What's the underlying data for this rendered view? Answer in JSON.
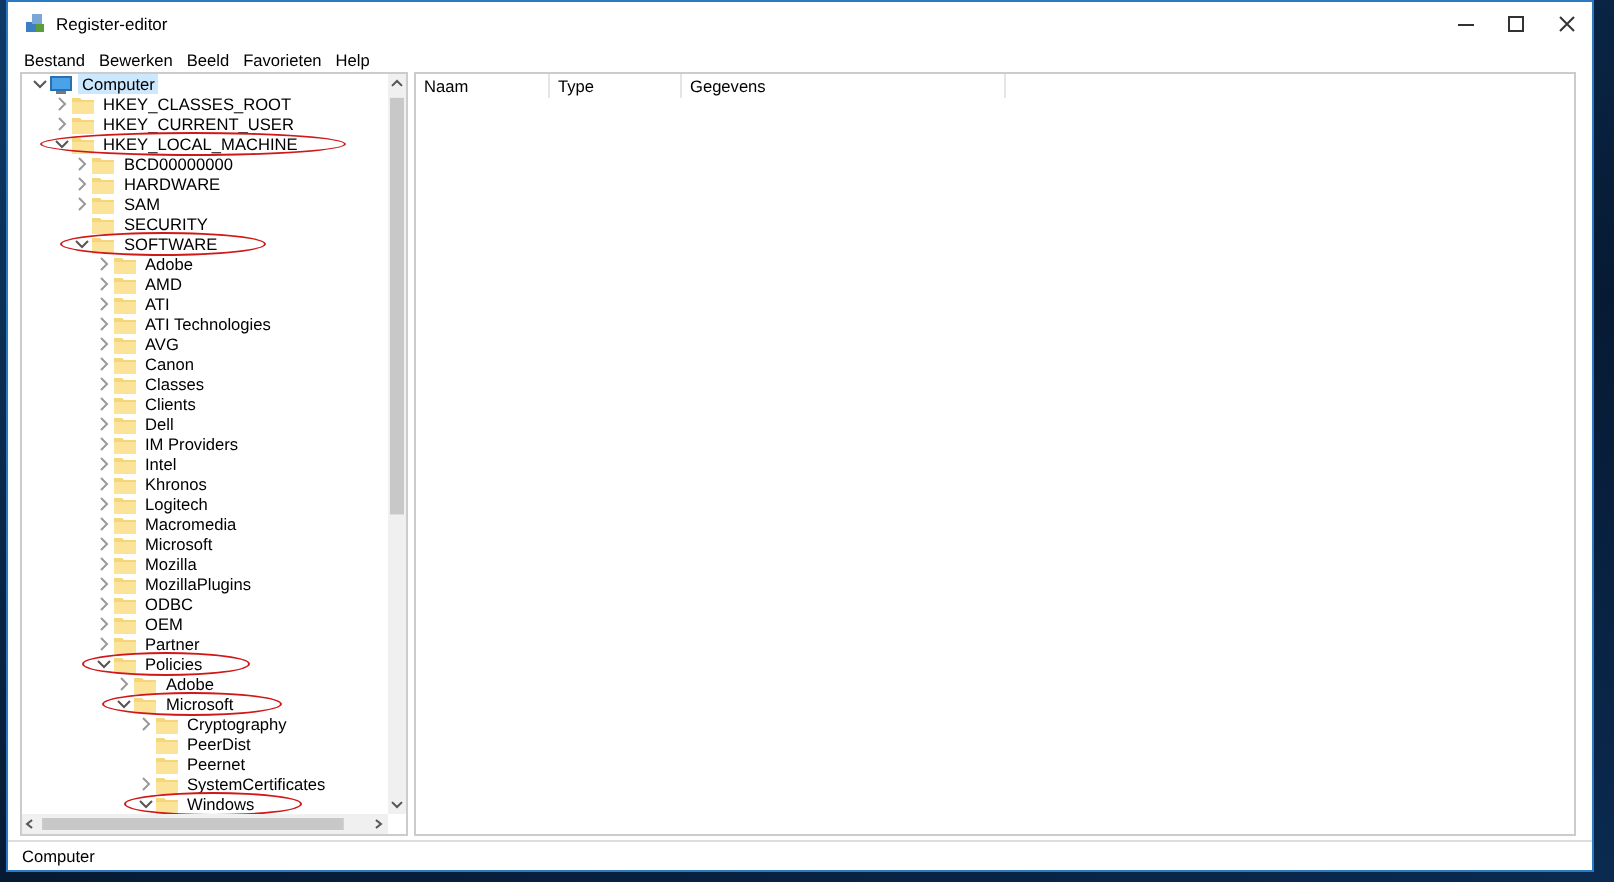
{
  "window": {
    "title": "Register-editor"
  },
  "menu": [
    "Bestand",
    "Bewerken",
    "Beeld",
    "Favorieten",
    "Help"
  ],
  "tree": [
    {
      "label": "Computer",
      "expanded": true,
      "selected": true,
      "circled": false,
      "children": [
        {
          "label": "HKEY_CLASSES_ROOT",
          "expanded": false,
          "selected": false,
          "circled": false
        },
        {
          "label": "HKEY_CURRENT_USER",
          "expanded": false,
          "selected": false,
          "circled": false
        },
        {
          "label": "HKEY_LOCAL_MACHINE",
          "expanded": true,
          "selected": false,
          "circled": true,
          "children": [
            {
              "label": "BCD00000000",
              "expanded": false,
              "selected": false,
              "circled": false
            },
            {
              "label": "HARDWARE",
              "expanded": false,
              "selected": false,
              "circled": false
            },
            {
              "label": "SAM",
              "expanded": false,
              "selected": false,
              "circled": false
            },
            {
              "label": "SECURITY",
              "kind": "leaf",
              "selected": false,
              "circled": false
            },
            {
              "label": "SOFTWARE",
              "expanded": true,
              "selected": false,
              "circled": true,
              "children": [
                {
                  "label": "Adobe",
                  "expanded": false,
                  "selected": false,
                  "circled": false
                },
                {
                  "label": "AMD",
                  "expanded": false,
                  "selected": false,
                  "circled": false
                },
                {
                  "label": "ATI",
                  "expanded": false,
                  "selected": false,
                  "circled": false
                },
                {
                  "label": "ATI Technologies",
                  "expanded": false,
                  "selected": false,
                  "circled": false
                },
                {
                  "label": "AVG",
                  "expanded": false,
                  "selected": false,
                  "circled": false
                },
                {
                  "label": "Canon",
                  "expanded": false,
                  "selected": false,
                  "circled": false
                },
                {
                  "label": "Classes",
                  "expanded": false,
                  "selected": false,
                  "circled": false
                },
                {
                  "label": "Clients",
                  "expanded": false,
                  "selected": false,
                  "circled": false
                },
                {
                  "label": "Dell",
                  "expanded": false,
                  "selected": false,
                  "circled": false
                },
                {
                  "label": "IM Providers",
                  "expanded": false,
                  "selected": false,
                  "circled": false
                },
                {
                  "label": "Intel",
                  "expanded": false,
                  "selected": false,
                  "circled": false
                },
                {
                  "label": "Khronos",
                  "expanded": false,
                  "selected": false,
                  "circled": false
                },
                {
                  "label": "Logitech",
                  "expanded": false,
                  "selected": false,
                  "circled": false
                },
                {
                  "label": "Macromedia",
                  "expanded": false,
                  "selected": false,
                  "circled": false
                },
                {
                  "label": "Microsoft",
                  "expanded": false,
                  "selected": false,
                  "circled": false
                },
                {
                  "label": "Mozilla",
                  "expanded": false,
                  "selected": false,
                  "circled": false
                },
                {
                  "label": "MozillaPlugins",
                  "expanded": false,
                  "selected": false,
                  "circled": false
                },
                {
                  "label": "ODBC",
                  "expanded": false,
                  "selected": false,
                  "circled": false
                },
                {
                  "label": "OEM",
                  "expanded": false,
                  "selected": false,
                  "circled": false
                },
                {
                  "label": "Partner",
                  "expanded": false,
                  "selected": false,
                  "circled": false
                },
                {
                  "label": "Policies",
                  "expanded": true,
                  "selected": false,
                  "circled": true,
                  "children": [
                    {
                      "label": "Adobe",
                      "expanded": false,
                      "selected": false,
                      "circled": false
                    },
                    {
                      "label": "Microsoft",
                      "expanded": true,
                      "selected": false,
                      "circled": true,
                      "children": [
                        {
                          "label": "Cryptography",
                          "expanded": false,
                          "selected": false,
                          "circled": false
                        },
                        {
                          "label": "PeerDist",
                          "kind": "leaf",
                          "selected": false,
                          "circled": false
                        },
                        {
                          "label": "Peernet",
                          "kind": "leaf",
                          "selected": false,
                          "circled": false
                        },
                        {
                          "label": "SystemCertificates",
                          "expanded": false,
                          "selected": false,
                          "circled": false
                        },
                        {
                          "label": "Windows",
                          "expanded": true,
                          "selected": false,
                          "circled": true
                        }
                      ]
                    }
                  ]
                }
              ]
            }
          ]
        }
      ]
    }
  ],
  "list": {
    "columns": [
      "Naam",
      "Type",
      "Gegevens"
    ]
  },
  "status_bar": "Computer"
}
